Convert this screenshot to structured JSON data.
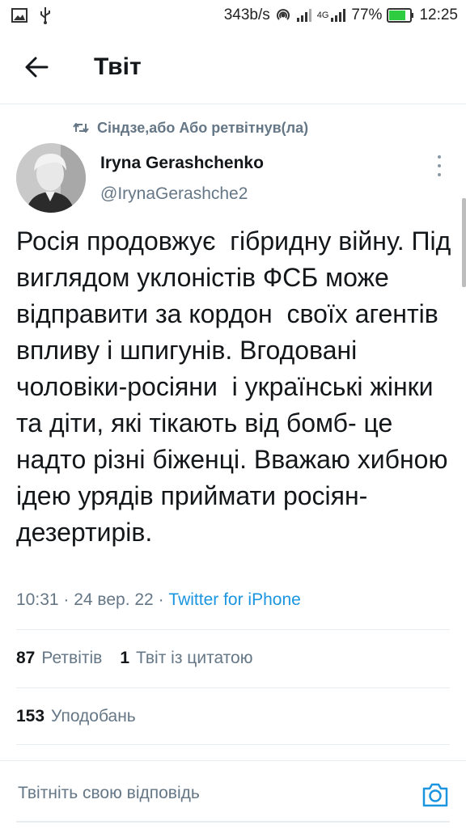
{
  "status_bar": {
    "speed": "343b/s",
    "network": "4G",
    "battery": "77%",
    "time": "12:25",
    "icons": [
      "image-icon",
      "usb-icon",
      "hotspot-icon",
      "signal-icon",
      "battery-icon"
    ]
  },
  "header": {
    "title": "Твіт"
  },
  "retweet": {
    "label": "Сіндзе,або Або ретвітнув(ла)"
  },
  "author": {
    "name": "Iryna Gerashchenko",
    "handle": "@IrynaGerashche2"
  },
  "tweet": {
    "text": "Росія продовжує  гібридну війну. Під виглядом уклоністів ФСБ може відправити за кордон  своїх агентів впливу і шпигунів. Вгодовані чоловіки-росіяни  і українські жінки та діти, які тікають від бомб- це надто різні біженці. Вважаю хибною ідею урядів приймати росіян- дезертирів.",
    "time": "10:31",
    "date": "24 вер. 22",
    "sep": " · ",
    "source": "Twitter for iPhone"
  },
  "stats": {
    "retweets_count": "87",
    "retweets_label": "Ретвітів",
    "quotes_count": "1",
    "quotes_label": "Твіт із цитатою",
    "likes_count": "153",
    "likes_label": "Уподобань"
  },
  "reply": {
    "placeholder": "Твітніть свою відповідь"
  },
  "colors": {
    "accent": "#1b95e0",
    "muted": "#657786",
    "text": "#14171a",
    "battery": "#2ecc40"
  }
}
